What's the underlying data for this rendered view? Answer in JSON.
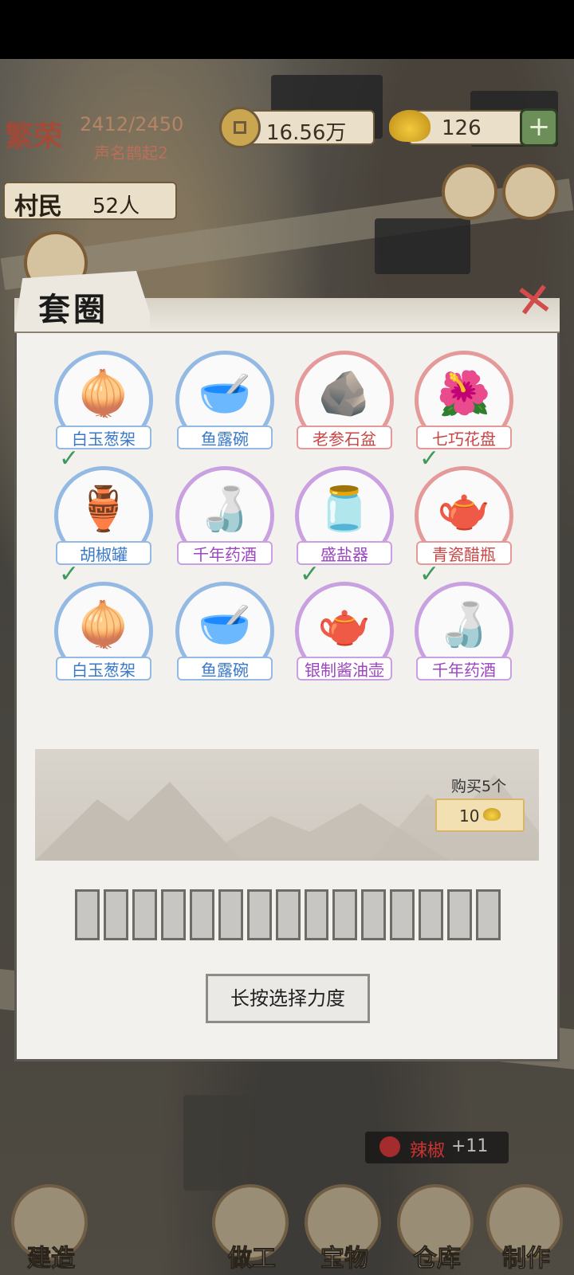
{
  "hud": {
    "fame_icon_text": "繁荣",
    "fame_count": "2412/2450",
    "fame_level": "声名鹊起2",
    "coins": "16.56万",
    "gold": "126",
    "plus": "+",
    "villager_label": "村民",
    "villager_count": "52人"
  },
  "dialog": {
    "title": "套圈",
    "close": "✕",
    "items": [
      {
        "label": "白玉葱架",
        "rarity": "blue",
        "icon": "scallion-icon",
        "glyph": "🧅",
        "checked": false
      },
      {
        "label": "鱼露碗",
        "rarity": "blue",
        "icon": "bowl-icon",
        "glyph": "🥣",
        "checked": false
      },
      {
        "label": "老参石盆",
        "rarity": "red",
        "icon": "ginseng-bowl-icon",
        "glyph": "🪨",
        "checked": false
      },
      {
        "label": "七巧花盘",
        "rarity": "red",
        "icon": "flower-plate-icon",
        "glyph": "🌺",
        "checked": false
      },
      {
        "label": "胡椒罐",
        "rarity": "blue",
        "icon": "pepper-jar-icon",
        "glyph": "🏺",
        "checked": true
      },
      {
        "label": "千年药酒",
        "rarity": "purple",
        "icon": "wine-jar-icon",
        "glyph": "🍶",
        "checked": false
      },
      {
        "label": "盛盐器",
        "rarity": "purple",
        "icon": "salt-pot-icon",
        "glyph": "🫙",
        "checked": false
      },
      {
        "label": "青瓷醋瓶",
        "rarity": "red",
        "icon": "teapot-icon",
        "glyph": "🫖",
        "checked": true
      },
      {
        "label": "白玉葱架",
        "rarity": "blue",
        "icon": "scallion-icon",
        "glyph": "🧅",
        "checked": true
      },
      {
        "label": "鱼露碗",
        "rarity": "blue",
        "icon": "bowl-icon",
        "glyph": "🥣",
        "checked": false
      },
      {
        "label": "银制酱油壶",
        "rarity": "purple",
        "icon": "silver-kettle-icon",
        "glyph": "🫖",
        "checked": true
      },
      {
        "label": "千年药酒",
        "rarity": "purple",
        "icon": "wine-jar-icon",
        "glyph": "🍶",
        "checked": true
      }
    ],
    "buy_label": "购买5个",
    "buy_price": "10",
    "power_segments": 15,
    "press_button": "长按选择力度"
  },
  "toast": {
    "item": "辣椒",
    "amount": "+11"
  },
  "nav": [
    {
      "label": "建造"
    },
    {
      "label": "做工"
    },
    {
      "label": "宝物"
    },
    {
      "label": "仓库"
    },
    {
      "label": "制作"
    }
  ],
  "colors": {
    "rarity_blue": "#94b9e3",
    "rarity_red": "#e59a9a",
    "rarity_purple": "#c9a0e0",
    "check_green": "#3c9a5c",
    "close_red": "#d34b4b"
  }
}
